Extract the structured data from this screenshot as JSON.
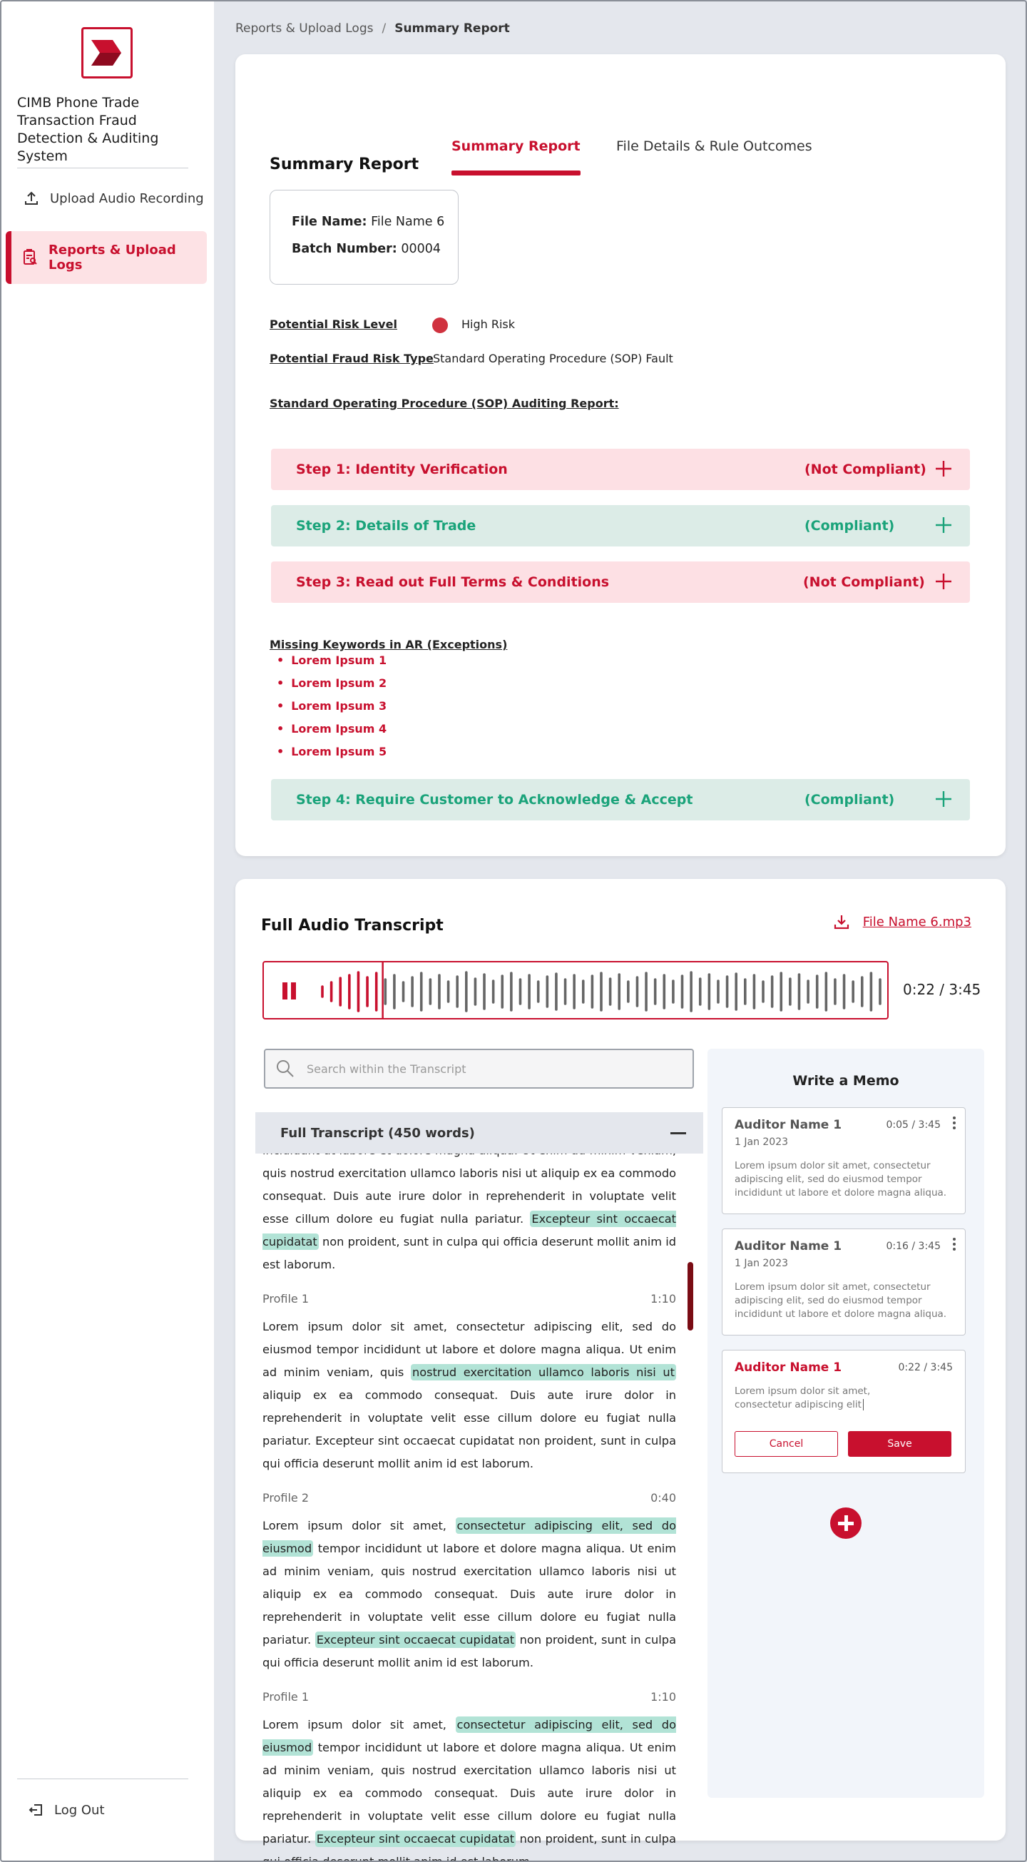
{
  "sidebar": {
    "app_title": "CIMB Phone Trade Transaction Fraud Detection & Auditing System",
    "items": [
      {
        "label": "Upload Audio Recording",
        "icon": "upload-icon"
      },
      {
        "label": "Reports & Upload Logs",
        "icon": "report-search-icon",
        "active": true
      }
    ],
    "logout_label": "Log Out"
  },
  "breadcrumb": {
    "parent": "Reports & Upload Logs",
    "separator": "/",
    "current": "Summary Report"
  },
  "tabs": [
    {
      "label": "Summary Report",
      "active": true
    },
    {
      "label": "File Details & Rule Outcomes",
      "active": false
    }
  ],
  "summary": {
    "title": "Summary Report",
    "file_name_label": "File Name:",
    "file_name": "File Name 6",
    "batch_label": "Batch Number:",
    "batch_number": "00004",
    "risk_level_label": "Potential Risk Level",
    "risk_level": "High Risk",
    "risk_color": "#d0323f",
    "fraud_type_label": "Potential Fraud Risk Type",
    "fraud_type": "Standard Operating Procedure (SOP) Fault",
    "sop_report_label": "Standard Operating Procedure (SOP) Auditing Report:",
    "steps": [
      {
        "label": "Step 1: Identity Verification",
        "status": "(Not Compliant)"
      },
      {
        "label": "Step 2: Details of Trade",
        "status": "(Compliant)"
      },
      {
        "label": "Step 3: Read out Full Terms & Conditions",
        "status": "(Not Compliant)"
      },
      {
        "label": "Step 4: Require Customer to Acknowledge & Accept",
        "status": "(Compliant)"
      }
    ],
    "missing_keywords_label": "Missing Keywords in AR (Exceptions)",
    "missing_keywords": [
      "Lorem Ipsum 1",
      "Lorem Ipsum 2",
      "Lorem Ipsum 3",
      "Lorem Ipsum 4",
      "Lorem Ipsum 5"
    ]
  },
  "audio": {
    "title": "Full Audio Transcript",
    "file_link": "File Name 6.mp3",
    "time": "0:22 / 3:45",
    "progress": 0.098,
    "search_placeholder": "Search within the Transcript",
    "transcript_header": "Full Transcript (450 words)",
    "blocks": [
      {
        "profile": "",
        "time": "",
        "pre": "incididunt ut labore et dolore magna aliqua. Ut enim ad minim veniam, quis nostrud exercitation ullamco laboris nisi ut aliquip ex ea commodo consequat. Duis aute irure dolor in reprehenderit in voluptate velit esse cillum dolore eu fugiat nulla pariatur. ",
        "hl1": "Excepteur sint occaecat cupidatat",
        "post": " non proident, sunt in culpa qui officia deserunt mollit anim id est laborum."
      },
      {
        "profile": "Profile 1",
        "time": "1:10",
        "pre": "Lorem ipsum dolor sit amet, consectetur adipiscing elit, sed do eiusmod tempor incididunt ut labore et dolore magna aliqua. Ut enim ad minim veniam, quis ",
        "hl1": "nostrud exercitation ullamco laboris nisi ut",
        "post": " aliquip ex ea commodo consequat. Duis aute irure dolor in reprehenderit in voluptate velit esse cillum dolore eu fugiat nulla pariatur. Excepteur sint occaecat cupidatat non proident, sunt in culpa qui officia deserunt mollit anim id est laborum."
      },
      {
        "profile": "Profile 2",
        "time": "0:40",
        "pre": "Lorem ipsum dolor sit amet, ",
        "hl1": "consectetur adipiscing elit, sed do eiusmod",
        "mid": " tempor incididunt ut labore et dolore magna aliqua. Ut enim ad minim veniam, quis nostrud exercitation ullamco laboris nisi ut aliquip ex ea commodo consequat. Duis aute irure dolor in reprehenderit in voluptate velit esse cillum dolore eu fugiat nulla pariatur. ",
        "hl2": "Excepteur sint occaecat cupidatat",
        "post": " non proident, sunt in culpa qui officia deserunt mollit anim id est laborum."
      },
      {
        "profile": "Profile 1",
        "time": "1:10",
        "pre": "Lorem ipsum dolor sit amet, ",
        "hl1": "consectetur adipiscing elit, sed do eiusmod",
        "mid": " tempor incididunt ut labore et dolore magna aliqua. Ut enim ad minim veniam, quis nostrud exercitation ullamco laboris nisi ut aliquip ex ea commodo consequat. Duis aute irure dolor in reprehenderit in voluptate velit esse cillum dolore eu fugiat nulla pariatur. ",
        "hl2": "Excepteur sint occaecat cupidatat",
        "post": " non proident, sunt in culpa qui officia deserunt mollit anim id est laborum."
      }
    ]
  },
  "memo": {
    "title": "Write a Memo",
    "notes": [
      {
        "author": "Auditor Name 1",
        "time": "0:05 / 3:45",
        "date": "1 Jan 2023",
        "text": "Lorem ipsum dolor sit amet, consectetur adipiscing elit, sed do eiusmod tempor incididunt ut labore et dolore magna aliqua."
      },
      {
        "author": "Auditor Name 1",
        "time": "0:16 / 3:45",
        "date": "1 Jan 2023",
        "text": "Lorem ipsum dolor sit amet, consectetur adipiscing elit, sed do eiusmod tempor incididunt ut labore et dolore magna aliqua."
      }
    ],
    "draft": {
      "author": "Auditor Name 1",
      "time": "0:22 / 3:45",
      "text": "Lorem ipsum dolor sit amet, consectetur adipiscing elit"
    },
    "cancel_label": "Cancel",
    "save_label": "Save"
  },
  "colors": {
    "brand": "#c8102e",
    "compliant": "#1aa37a",
    "highlight": "#b2e3d6"
  }
}
